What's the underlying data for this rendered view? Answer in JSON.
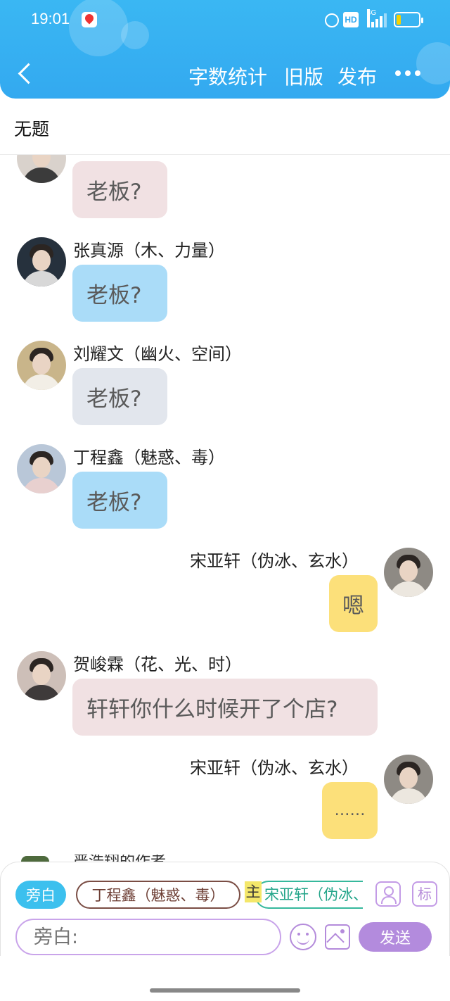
{
  "status_bar": {
    "time": "19:01",
    "hd_label": "HD",
    "network_label": "4G"
  },
  "header": {
    "word_count_label": "字数统计",
    "old_version_label": "旧版",
    "publish_label": "发布",
    "colors": {
      "accent": "#33a9f0"
    }
  },
  "document": {
    "title": "无题"
  },
  "messages": [
    {
      "sender": "",
      "text": "老板?",
      "side": "left",
      "bubble_color": "#f1e1e3"
    },
    {
      "sender": "张真源（木、力量）",
      "text": "老板?",
      "side": "left",
      "bubble_color": "#aadcf8"
    },
    {
      "sender": "刘耀文（幽火、空间）",
      "text": "老板?",
      "side": "left",
      "bubble_color": "#e2e6ed"
    },
    {
      "sender": "丁程鑫（魅惑、毒）",
      "text": "老板?",
      "side": "left",
      "bubble_color": "#aadcf8"
    },
    {
      "sender": "宋亚轩（伪冰、玄水）",
      "text": "嗯",
      "side": "right",
      "bubble_color": "#fce07a"
    },
    {
      "sender": "贺峻霖（花、光、时）",
      "text": "轩轩你什么时候开了个店?",
      "side": "left",
      "bubble_color": "#f1e1e3"
    },
    {
      "sender": "宋亚轩（伪冰、玄水）",
      "text": "……",
      "side": "right",
      "bubble_color": "#fce07a"
    }
  ],
  "partial_sender": "严浩翔的作者",
  "composer": {
    "narration_label": "旁白",
    "selected_character": "丁程鑫（魅惑、毒）",
    "main_tag": "主",
    "main_character": "宋亚轩（伪冰、玄水）",
    "tag_label": "标",
    "input_placeholder": "旁白:",
    "send_label": "发送"
  },
  "icons": [
    "back-icon",
    "more-icon",
    "alarm-icon",
    "signal-icon",
    "battery-icon",
    "user-card-icon",
    "emoji-icon",
    "image-icon"
  ]
}
